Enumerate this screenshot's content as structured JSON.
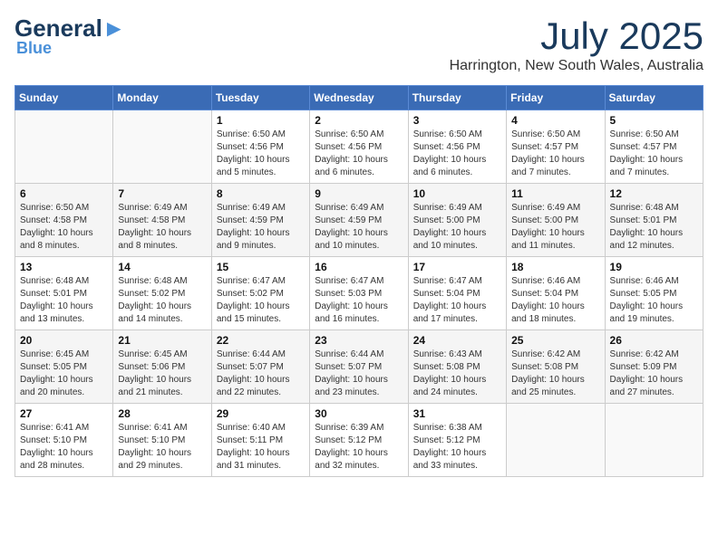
{
  "header": {
    "logo_general": "General",
    "logo_blue": "Blue",
    "month_title": "July 2025",
    "location": "Harrington, New South Wales, Australia"
  },
  "calendar": {
    "days_of_week": [
      "Sunday",
      "Monday",
      "Tuesday",
      "Wednesday",
      "Thursday",
      "Friday",
      "Saturday"
    ],
    "weeks": [
      [
        {
          "day": "",
          "info": ""
        },
        {
          "day": "",
          "info": ""
        },
        {
          "day": "1",
          "info": "Sunrise: 6:50 AM\nSunset: 4:56 PM\nDaylight: 10 hours\nand 5 minutes."
        },
        {
          "day": "2",
          "info": "Sunrise: 6:50 AM\nSunset: 4:56 PM\nDaylight: 10 hours\nand 6 minutes."
        },
        {
          "day": "3",
          "info": "Sunrise: 6:50 AM\nSunset: 4:56 PM\nDaylight: 10 hours\nand 6 minutes."
        },
        {
          "day": "4",
          "info": "Sunrise: 6:50 AM\nSunset: 4:57 PM\nDaylight: 10 hours\nand 7 minutes."
        },
        {
          "day": "5",
          "info": "Sunrise: 6:50 AM\nSunset: 4:57 PM\nDaylight: 10 hours\nand 7 minutes."
        }
      ],
      [
        {
          "day": "6",
          "info": "Sunrise: 6:50 AM\nSunset: 4:58 PM\nDaylight: 10 hours\nand 8 minutes."
        },
        {
          "day": "7",
          "info": "Sunrise: 6:49 AM\nSunset: 4:58 PM\nDaylight: 10 hours\nand 8 minutes."
        },
        {
          "day": "8",
          "info": "Sunrise: 6:49 AM\nSunset: 4:59 PM\nDaylight: 10 hours\nand 9 minutes."
        },
        {
          "day": "9",
          "info": "Sunrise: 6:49 AM\nSunset: 4:59 PM\nDaylight: 10 hours\nand 10 minutes."
        },
        {
          "day": "10",
          "info": "Sunrise: 6:49 AM\nSunset: 5:00 PM\nDaylight: 10 hours\nand 10 minutes."
        },
        {
          "day": "11",
          "info": "Sunrise: 6:49 AM\nSunset: 5:00 PM\nDaylight: 10 hours\nand 11 minutes."
        },
        {
          "day": "12",
          "info": "Sunrise: 6:48 AM\nSunset: 5:01 PM\nDaylight: 10 hours\nand 12 minutes."
        }
      ],
      [
        {
          "day": "13",
          "info": "Sunrise: 6:48 AM\nSunset: 5:01 PM\nDaylight: 10 hours\nand 13 minutes."
        },
        {
          "day": "14",
          "info": "Sunrise: 6:48 AM\nSunset: 5:02 PM\nDaylight: 10 hours\nand 14 minutes."
        },
        {
          "day": "15",
          "info": "Sunrise: 6:47 AM\nSunset: 5:02 PM\nDaylight: 10 hours\nand 15 minutes."
        },
        {
          "day": "16",
          "info": "Sunrise: 6:47 AM\nSunset: 5:03 PM\nDaylight: 10 hours\nand 16 minutes."
        },
        {
          "day": "17",
          "info": "Sunrise: 6:47 AM\nSunset: 5:04 PM\nDaylight: 10 hours\nand 17 minutes."
        },
        {
          "day": "18",
          "info": "Sunrise: 6:46 AM\nSunset: 5:04 PM\nDaylight: 10 hours\nand 18 minutes."
        },
        {
          "day": "19",
          "info": "Sunrise: 6:46 AM\nSunset: 5:05 PM\nDaylight: 10 hours\nand 19 minutes."
        }
      ],
      [
        {
          "day": "20",
          "info": "Sunrise: 6:45 AM\nSunset: 5:05 PM\nDaylight: 10 hours\nand 20 minutes."
        },
        {
          "day": "21",
          "info": "Sunrise: 6:45 AM\nSunset: 5:06 PM\nDaylight: 10 hours\nand 21 minutes."
        },
        {
          "day": "22",
          "info": "Sunrise: 6:44 AM\nSunset: 5:07 PM\nDaylight: 10 hours\nand 22 minutes."
        },
        {
          "day": "23",
          "info": "Sunrise: 6:44 AM\nSunset: 5:07 PM\nDaylight: 10 hours\nand 23 minutes."
        },
        {
          "day": "24",
          "info": "Sunrise: 6:43 AM\nSunset: 5:08 PM\nDaylight: 10 hours\nand 24 minutes."
        },
        {
          "day": "25",
          "info": "Sunrise: 6:42 AM\nSunset: 5:08 PM\nDaylight: 10 hours\nand 25 minutes."
        },
        {
          "day": "26",
          "info": "Sunrise: 6:42 AM\nSunset: 5:09 PM\nDaylight: 10 hours\nand 27 minutes."
        }
      ],
      [
        {
          "day": "27",
          "info": "Sunrise: 6:41 AM\nSunset: 5:10 PM\nDaylight: 10 hours\nand 28 minutes."
        },
        {
          "day": "28",
          "info": "Sunrise: 6:41 AM\nSunset: 5:10 PM\nDaylight: 10 hours\nand 29 minutes."
        },
        {
          "day": "29",
          "info": "Sunrise: 6:40 AM\nSunset: 5:11 PM\nDaylight: 10 hours\nand 31 minutes."
        },
        {
          "day": "30",
          "info": "Sunrise: 6:39 AM\nSunset: 5:12 PM\nDaylight: 10 hours\nand 32 minutes."
        },
        {
          "day": "31",
          "info": "Sunrise: 6:38 AM\nSunset: 5:12 PM\nDaylight: 10 hours\nand 33 minutes."
        },
        {
          "day": "",
          "info": ""
        },
        {
          "day": "",
          "info": ""
        }
      ]
    ]
  }
}
